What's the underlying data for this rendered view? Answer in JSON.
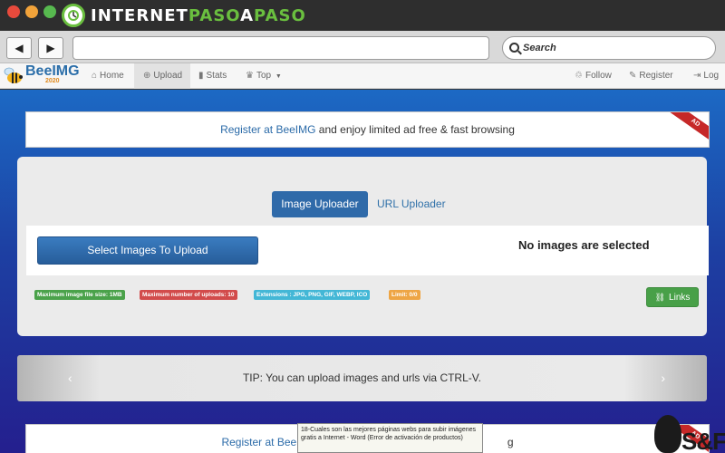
{
  "browser": {
    "brand_prefix": "INTERNET",
    "brand_accent": "PASO",
    "brand_mid": "A",
    "brand_suffix": "PASO",
    "url_value": "",
    "search_placeholder": "Search",
    "nav_back": "◀",
    "nav_forward": "▶"
  },
  "site": {
    "logo_name": "BeeIMG",
    "logo_year": "2020",
    "nav_left": [
      {
        "icon": "home-icon",
        "glyph": "⌂",
        "label": "Home"
      },
      {
        "icon": "upload-icon",
        "glyph": "⊕",
        "label": "Upload"
      },
      {
        "icon": "stats-icon",
        "glyph": "▮",
        "label": "Stats"
      },
      {
        "icon": "trophy-icon",
        "glyph": "♛",
        "label": "Top"
      }
    ],
    "nav_right": [
      {
        "icon": "thumbs-up-icon",
        "glyph": "♲",
        "label": "Follow"
      },
      {
        "icon": "register-icon",
        "glyph": "✎",
        "label": "Register"
      },
      {
        "icon": "login-icon",
        "glyph": "⇥",
        "label": "Log"
      }
    ]
  },
  "ad_top": {
    "link": "Register at BeeIMG",
    "rest": " and enjoy limited ad free & fast browsing",
    "ribbon": "AD"
  },
  "uploader": {
    "tab_image": "Image Uploader",
    "tab_url": "URL Uploader",
    "select_button": "Select Images To Upload",
    "no_images": "No images are selected",
    "badges": [
      {
        "label": "Maximum image file size: 1MB",
        "color": "#4aa24a"
      },
      {
        "label": "Maximum number of uploads: 10",
        "color": "#d24b4b"
      },
      {
        "label": "Extensions : JPG, PNG, GIF, WEBP, ICO",
        "color": "#43b7d6"
      },
      {
        "label": "Limit: 0/0",
        "color": "#eea544"
      }
    ],
    "links_button": "Links"
  },
  "tip": {
    "text": "TIP: You can upload images and urls via CTRL-V.",
    "prev": "‹",
    "next": "›"
  },
  "ad_bottom": {
    "link": "Register at BeeIMG",
    "rest_visible": "g",
    "ribbon": "AD"
  },
  "tooltip": {
    "text": "18-Cuales son las mejores páginas webs para subir imágenes gratis a Internet - Word (Error de activación de productos)"
  },
  "corner_logo": {
    "text": "S&F"
  },
  "colors": {
    "page_top": "#1c69c4",
    "page_bottom": "#241f8e",
    "primary": "#2f6aa9",
    "success": "#48a048"
  }
}
